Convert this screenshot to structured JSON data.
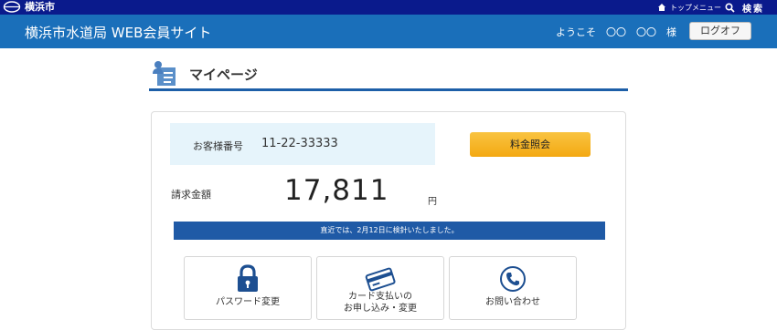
{
  "topbar": {
    "city": "横浜市",
    "menu_label": "トップメニュー",
    "search_label": "検索"
  },
  "header": {
    "title": "横浜市水道局 WEB会員サイト",
    "welcome": "ようこそ　〇〇　〇〇　様",
    "logout_label": "ログオフ"
  },
  "page": {
    "heading": "マイページ"
  },
  "account": {
    "customer_label": "お客様番号",
    "customer_number": "11-22-33333",
    "fee_button": "料金照会",
    "bill_label": "請求金額",
    "bill_amount": "17,811",
    "bill_unit": "円",
    "notice": "直近では、2月12日に検針いたしました。"
  },
  "tiles": {
    "password": "パスワード変更",
    "card_line1": "カード支払いの",
    "card_line2": "お申し込み・変更",
    "contact": "お問い合わせ"
  },
  "colors": {
    "topbar": "#0a1a8c",
    "header": "#1a6fba",
    "accent": "#1d5fa8",
    "fee_button": "#f3a812",
    "customer_box": "#e6f4fb"
  },
  "icons": [
    "city-logo-icon",
    "home-icon",
    "search-icon",
    "user-card-icon",
    "lock-icon",
    "credit-card-icon",
    "phone-icon"
  ]
}
